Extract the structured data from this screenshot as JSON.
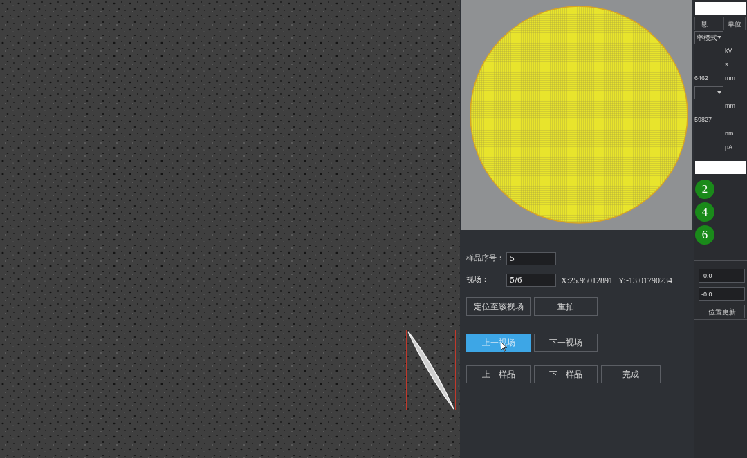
{
  "sample_panel": {
    "fields": [
      {
        "label": "样品序号：",
        "value": "5"
      },
      {
        "label": "视场：",
        "value": "5/6",
        "coordinates": [
          "X:25.95012891",
          "Y:-13.01790234"
        ]
      }
    ],
    "button_rows": [
      [
        {
          "label": "定位至该视场",
          "highlighted": false
        },
        {
          "label": "重拍",
          "highlighted": false
        }
      ],
      [
        {
          "label": "上一视场",
          "highlighted": true
        },
        {
          "label": "下一视场",
          "highlighted": false
        }
      ],
      [
        {
          "label": "上一样品",
          "highlighted": false
        },
        {
          "label": "下一样品",
          "highlighted": false
        },
        {
          "label": "完成",
          "highlighted": false
        }
      ]
    ]
  },
  "parameter_table": {
    "columns": [
      "息",
      "单位"
    ],
    "rows": [
      {
        "kind": "dropdown",
        "value": "率模式"
      },
      {
        "kind": "text",
        "unit": "kV"
      },
      {
        "kind": "text",
        "unit": "s"
      },
      {
        "kind": "text",
        "value": "6462",
        "unit": "mm"
      },
      {
        "kind": "dropdown"
      },
      {
        "kind": "text",
        "unit": "mm"
      },
      {
        "kind": "text",
        "value": "59827"
      },
      {
        "kind": "text",
        "unit": "nm"
      },
      {
        "kind": "text",
        "unit": "pA"
      }
    ]
  },
  "field_badges": [
    "2",
    "4",
    "6"
  ],
  "position_group": {
    "fields": [
      "-0.0",
      "-0.0"
    ],
    "button": "位置更新"
  }
}
